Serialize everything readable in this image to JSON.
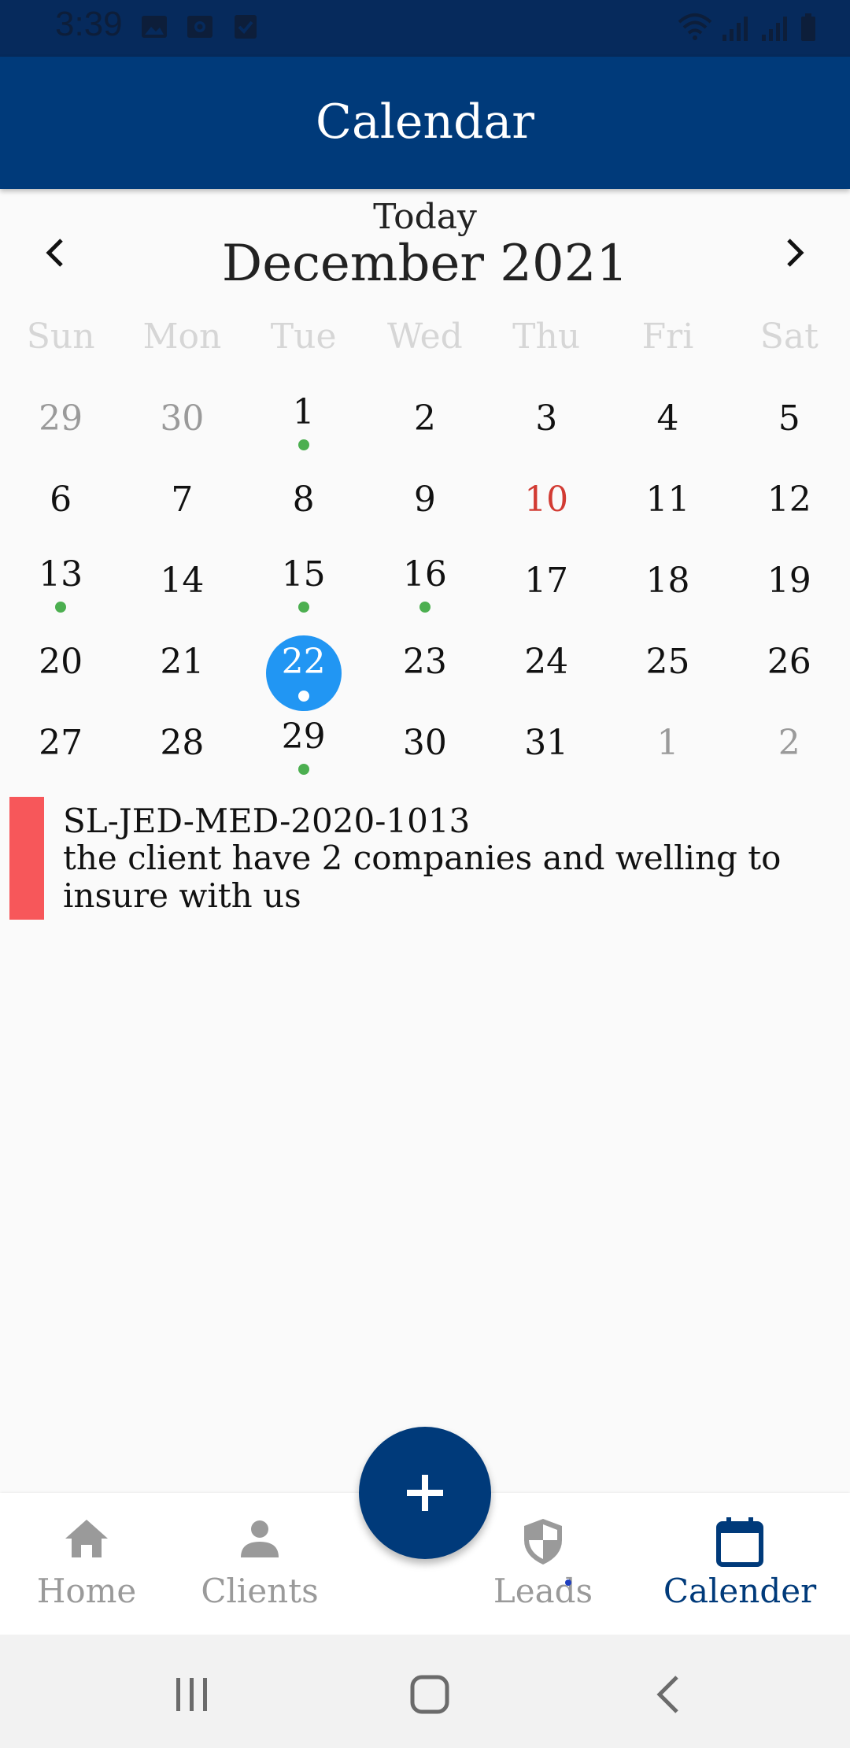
{
  "status_bar": {
    "time": "3:39",
    "icons": [
      "image-icon",
      "screen-record-icon",
      "checkbox-icon",
      "wifi-icon",
      "signal-icon",
      "signal-icon",
      "battery-icon"
    ]
  },
  "app_bar": {
    "title": "Calendar"
  },
  "calendar": {
    "today_label": "Today",
    "month_label": "December 2021",
    "weekdays": [
      "Sun",
      "Mon",
      "Tue",
      "Wed",
      "Thu",
      "Fri",
      "Sat"
    ],
    "weeks": [
      [
        {
          "d": "29",
          "muted": true
        },
        {
          "d": "30",
          "muted": true
        },
        {
          "d": "1",
          "event": true
        },
        {
          "d": "2"
        },
        {
          "d": "3"
        },
        {
          "d": "4"
        },
        {
          "d": "5"
        }
      ],
      [
        {
          "d": "6"
        },
        {
          "d": "7"
        },
        {
          "d": "8"
        },
        {
          "d": "9"
        },
        {
          "d": "10",
          "holiday": true
        },
        {
          "d": "11"
        },
        {
          "d": "12"
        }
      ],
      [
        {
          "d": "13",
          "event": true
        },
        {
          "d": "14"
        },
        {
          "d": "15",
          "event": true
        },
        {
          "d": "16",
          "event": true
        },
        {
          "d": "17"
        },
        {
          "d": "18"
        },
        {
          "d": "19"
        }
      ],
      [
        {
          "d": "20"
        },
        {
          "d": "21"
        },
        {
          "d": "22",
          "selected": true,
          "event": true
        },
        {
          "d": "23"
        },
        {
          "d": "24"
        },
        {
          "d": "25"
        },
        {
          "d": "26"
        }
      ],
      [
        {
          "d": "27"
        },
        {
          "d": "28"
        },
        {
          "d": "29",
          "event": true
        },
        {
          "d": "30"
        },
        {
          "d": "31"
        },
        {
          "d": "1",
          "muted": true
        },
        {
          "d": "2",
          "muted": true
        }
      ]
    ]
  },
  "event": {
    "title": "SL-JED-MED-2020-1013",
    "description": "the client have 2 companies and welling to insure with us",
    "color": "#f7575a"
  },
  "bottom_nav": {
    "home": "Home",
    "clients": "Clients",
    "leads": "Leads",
    "calendar": "Calender",
    "active": "calendar"
  },
  "fab": {
    "icon": "plus-icon"
  },
  "colors": {
    "primary": "#003a7a",
    "selected_day": "#2196f3",
    "event_dot": "#4caf50",
    "holiday": "#d23b33"
  }
}
